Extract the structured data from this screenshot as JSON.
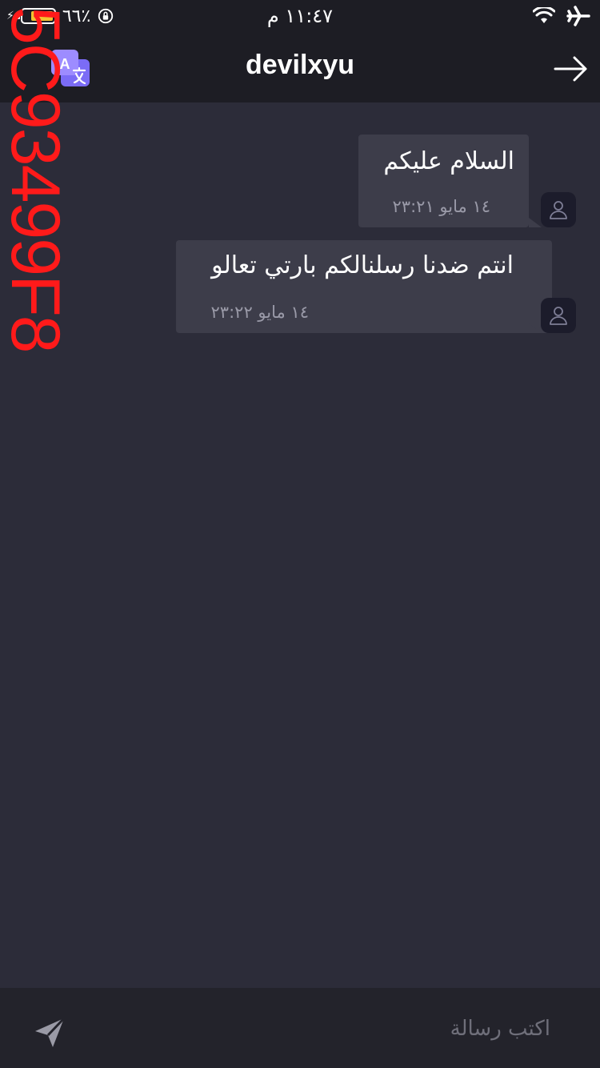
{
  "status_bar": {
    "time": "١١:٤٧ م",
    "battery_percent": "٦٦٪",
    "battery_level": 0.66,
    "battery_color": "#f2c230"
  },
  "header": {
    "title": "devilxyu",
    "translate_icon": "translate-icon",
    "back_icon": "arrow-right-icon"
  },
  "watermark": "5C93499F8",
  "messages": [
    {
      "text": "السلام عليكم",
      "timestamp": "١٤ مايو ٢٣:٢١"
    },
    {
      "text": "انتم ضدنا رسلنالكم بارتي تعالو",
      "timestamp": "١٤ مايو ٢٣:٢٢"
    }
  ],
  "composer": {
    "placeholder": "اكتب رسالة",
    "send_icon": "send-icon"
  },
  "colors": {
    "background": "#2c2c39",
    "header": "#1d1d24",
    "bubble": "#3d3d4a",
    "accent": "#7b6cf6",
    "watermark": "#ff1a1a"
  }
}
